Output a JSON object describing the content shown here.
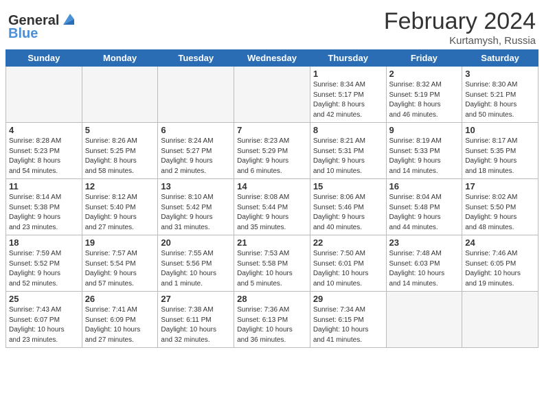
{
  "header": {
    "logo_line1": "General",
    "logo_line2": "Blue",
    "main_title": "February 2024",
    "sub_title": "Kurtamysh, Russia"
  },
  "weekdays": [
    "Sunday",
    "Monday",
    "Tuesday",
    "Wednesday",
    "Thursday",
    "Friday",
    "Saturday"
  ],
  "weeks": [
    [
      {
        "day": "",
        "detail": ""
      },
      {
        "day": "",
        "detail": ""
      },
      {
        "day": "",
        "detail": ""
      },
      {
        "day": "",
        "detail": ""
      },
      {
        "day": "1",
        "detail": "Sunrise: 8:34 AM\nSunset: 5:17 PM\nDaylight: 8 hours\nand 42 minutes."
      },
      {
        "day": "2",
        "detail": "Sunrise: 8:32 AM\nSunset: 5:19 PM\nDaylight: 8 hours\nand 46 minutes."
      },
      {
        "day": "3",
        "detail": "Sunrise: 8:30 AM\nSunset: 5:21 PM\nDaylight: 8 hours\nand 50 minutes."
      }
    ],
    [
      {
        "day": "4",
        "detail": "Sunrise: 8:28 AM\nSunset: 5:23 PM\nDaylight: 8 hours\nand 54 minutes."
      },
      {
        "day": "5",
        "detail": "Sunrise: 8:26 AM\nSunset: 5:25 PM\nDaylight: 8 hours\nand 58 minutes."
      },
      {
        "day": "6",
        "detail": "Sunrise: 8:24 AM\nSunset: 5:27 PM\nDaylight: 9 hours\nand 2 minutes."
      },
      {
        "day": "7",
        "detail": "Sunrise: 8:23 AM\nSunset: 5:29 PM\nDaylight: 9 hours\nand 6 minutes."
      },
      {
        "day": "8",
        "detail": "Sunrise: 8:21 AM\nSunset: 5:31 PM\nDaylight: 9 hours\nand 10 minutes."
      },
      {
        "day": "9",
        "detail": "Sunrise: 8:19 AM\nSunset: 5:33 PM\nDaylight: 9 hours\nand 14 minutes."
      },
      {
        "day": "10",
        "detail": "Sunrise: 8:17 AM\nSunset: 5:35 PM\nDaylight: 9 hours\nand 18 minutes."
      }
    ],
    [
      {
        "day": "11",
        "detail": "Sunrise: 8:14 AM\nSunset: 5:38 PM\nDaylight: 9 hours\nand 23 minutes."
      },
      {
        "day": "12",
        "detail": "Sunrise: 8:12 AM\nSunset: 5:40 PM\nDaylight: 9 hours\nand 27 minutes."
      },
      {
        "day": "13",
        "detail": "Sunrise: 8:10 AM\nSunset: 5:42 PM\nDaylight: 9 hours\nand 31 minutes."
      },
      {
        "day": "14",
        "detail": "Sunrise: 8:08 AM\nSunset: 5:44 PM\nDaylight: 9 hours\nand 35 minutes."
      },
      {
        "day": "15",
        "detail": "Sunrise: 8:06 AM\nSunset: 5:46 PM\nDaylight: 9 hours\nand 40 minutes."
      },
      {
        "day": "16",
        "detail": "Sunrise: 8:04 AM\nSunset: 5:48 PM\nDaylight: 9 hours\nand 44 minutes."
      },
      {
        "day": "17",
        "detail": "Sunrise: 8:02 AM\nSunset: 5:50 PM\nDaylight: 9 hours\nand 48 minutes."
      }
    ],
    [
      {
        "day": "18",
        "detail": "Sunrise: 7:59 AM\nSunset: 5:52 PM\nDaylight: 9 hours\nand 52 minutes."
      },
      {
        "day": "19",
        "detail": "Sunrise: 7:57 AM\nSunset: 5:54 PM\nDaylight: 9 hours\nand 57 minutes."
      },
      {
        "day": "20",
        "detail": "Sunrise: 7:55 AM\nSunset: 5:56 PM\nDaylight: 10 hours\nand 1 minute."
      },
      {
        "day": "21",
        "detail": "Sunrise: 7:53 AM\nSunset: 5:58 PM\nDaylight: 10 hours\nand 5 minutes."
      },
      {
        "day": "22",
        "detail": "Sunrise: 7:50 AM\nSunset: 6:01 PM\nDaylight: 10 hours\nand 10 minutes."
      },
      {
        "day": "23",
        "detail": "Sunrise: 7:48 AM\nSunset: 6:03 PM\nDaylight: 10 hours\nand 14 minutes."
      },
      {
        "day": "24",
        "detail": "Sunrise: 7:46 AM\nSunset: 6:05 PM\nDaylight: 10 hours\nand 19 minutes."
      }
    ],
    [
      {
        "day": "25",
        "detail": "Sunrise: 7:43 AM\nSunset: 6:07 PM\nDaylight: 10 hours\nand 23 minutes."
      },
      {
        "day": "26",
        "detail": "Sunrise: 7:41 AM\nSunset: 6:09 PM\nDaylight: 10 hours\nand 27 minutes."
      },
      {
        "day": "27",
        "detail": "Sunrise: 7:38 AM\nSunset: 6:11 PM\nDaylight: 10 hours\nand 32 minutes."
      },
      {
        "day": "28",
        "detail": "Sunrise: 7:36 AM\nSunset: 6:13 PM\nDaylight: 10 hours\nand 36 minutes."
      },
      {
        "day": "29",
        "detail": "Sunrise: 7:34 AM\nSunset: 6:15 PM\nDaylight: 10 hours\nand 41 minutes."
      },
      {
        "day": "",
        "detail": ""
      },
      {
        "day": "",
        "detail": ""
      }
    ]
  ]
}
